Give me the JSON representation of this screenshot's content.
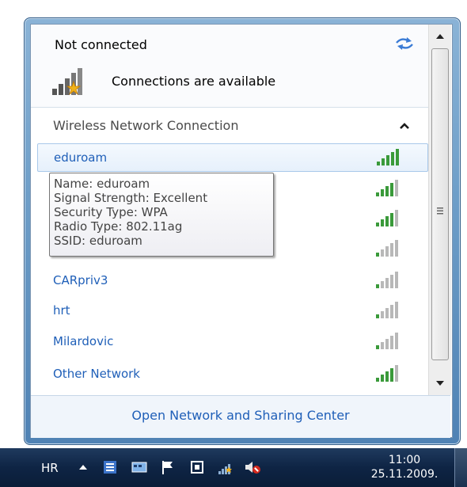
{
  "header": {
    "status": "Not connected",
    "availability": "Connections are available"
  },
  "section": {
    "title": "Wireless Network Connection"
  },
  "networks": [
    {
      "name": "eduroam",
      "selected": true
    },
    {
      "name": "",
      "selected": false
    },
    {
      "name": "",
      "selected": false
    },
    {
      "name": "",
      "selected": false
    },
    {
      "name": "CARpriv3",
      "selected": false
    },
    {
      "name": "hrt",
      "selected": false
    },
    {
      "name": "Milardovic",
      "selected": false
    },
    {
      "name": "Other Network",
      "selected": false
    }
  ],
  "tooltip": {
    "name": "Name: eduroam",
    "signal": "Signal Strength: Excellent",
    "security": "Security Type: WPA",
    "radio": "Radio Type: 802.11ag",
    "ssid": "SSID: eduroam"
  },
  "footer": {
    "link": "Open Network and Sharing Center"
  },
  "taskbar": {
    "language": "HR",
    "time": "11:00",
    "date": "25.11.2009."
  },
  "colors": {
    "link": "#1f5fb8",
    "taskbar": "#0e2444"
  },
  "icons": [
    "refresh-icon",
    "connections-available-icon",
    "collapse-icon",
    "signal-icon",
    "show-hidden-icons",
    "action-center-icon",
    "network-icon",
    "volume-muted-icon"
  ]
}
